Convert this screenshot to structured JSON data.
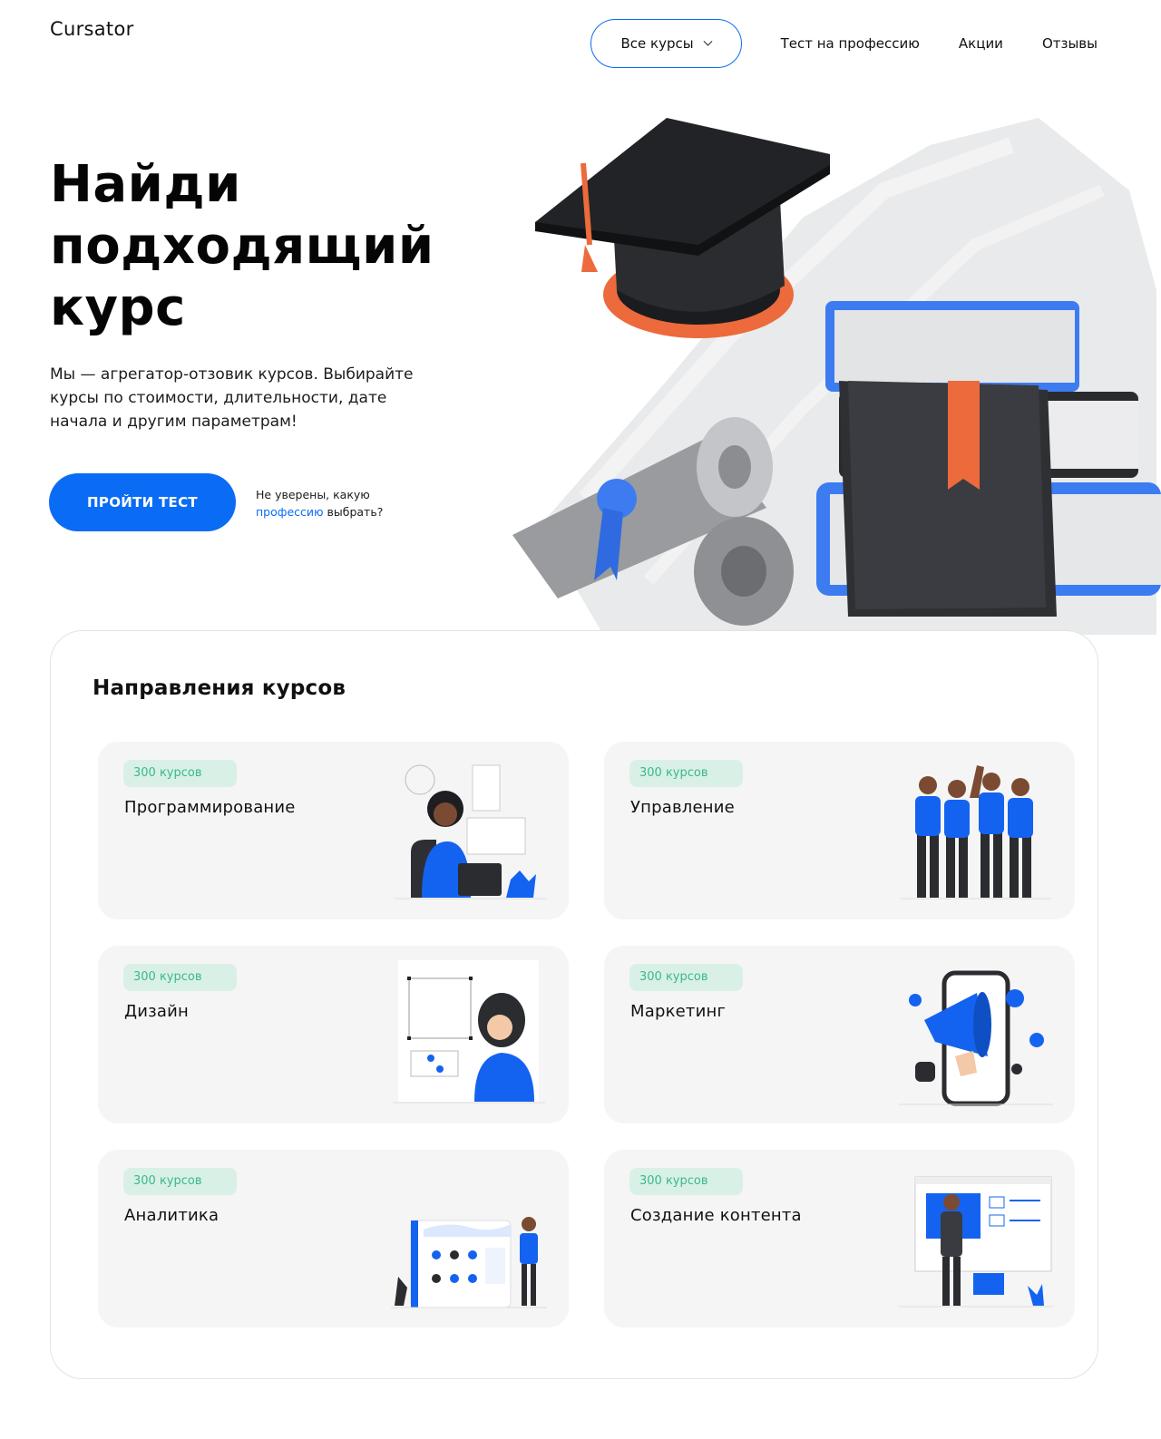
{
  "header": {
    "logo": "Cursator",
    "nav": {
      "dropdown_label": "Все курсы",
      "links": [
        "Тест на профессию",
        "Акции",
        "Отзывы"
      ]
    }
  },
  "hero": {
    "title_lines": [
      "Найди",
      "подходящий",
      "курс"
    ],
    "subtitle": "Мы — агрегатор-отзовик курсов. Выбирайте курсы по стоимости, длительности, дате начала и другим параметрам!",
    "cta_label": "ПРОЙТИ ТЕСТ",
    "note_before": "Не уверены, какую",
    "note_link": "профессию",
    "note_after": " выбрать?"
  },
  "directions": {
    "title": "Направления курсов",
    "cards": [
      {
        "count": "300 курсов",
        "title": "Программирование",
        "icon": "programmer-illustration"
      },
      {
        "count": "300 курсов",
        "title": "Управление",
        "icon": "team-illustration"
      },
      {
        "count": "300 курсов",
        "title": "Дизайн",
        "icon": "designer-illustration"
      },
      {
        "count": "300 курсов",
        "title": "Маркетинг",
        "icon": "megaphone-phone-illustration"
      },
      {
        "count": "300 курсов",
        "title": "Аналитика",
        "icon": "analytics-dashboard-illustration"
      },
      {
        "count": "300 курсов",
        "title": "Создание контента",
        "icon": "content-board-illustration"
      }
    ]
  },
  "colors": {
    "accent": "#0a6cf5",
    "badge_bg": "#d9f0e7",
    "badge_text": "#39b98a",
    "card_bg": "#f5f5f6",
    "orange": "#ec6a3c"
  }
}
